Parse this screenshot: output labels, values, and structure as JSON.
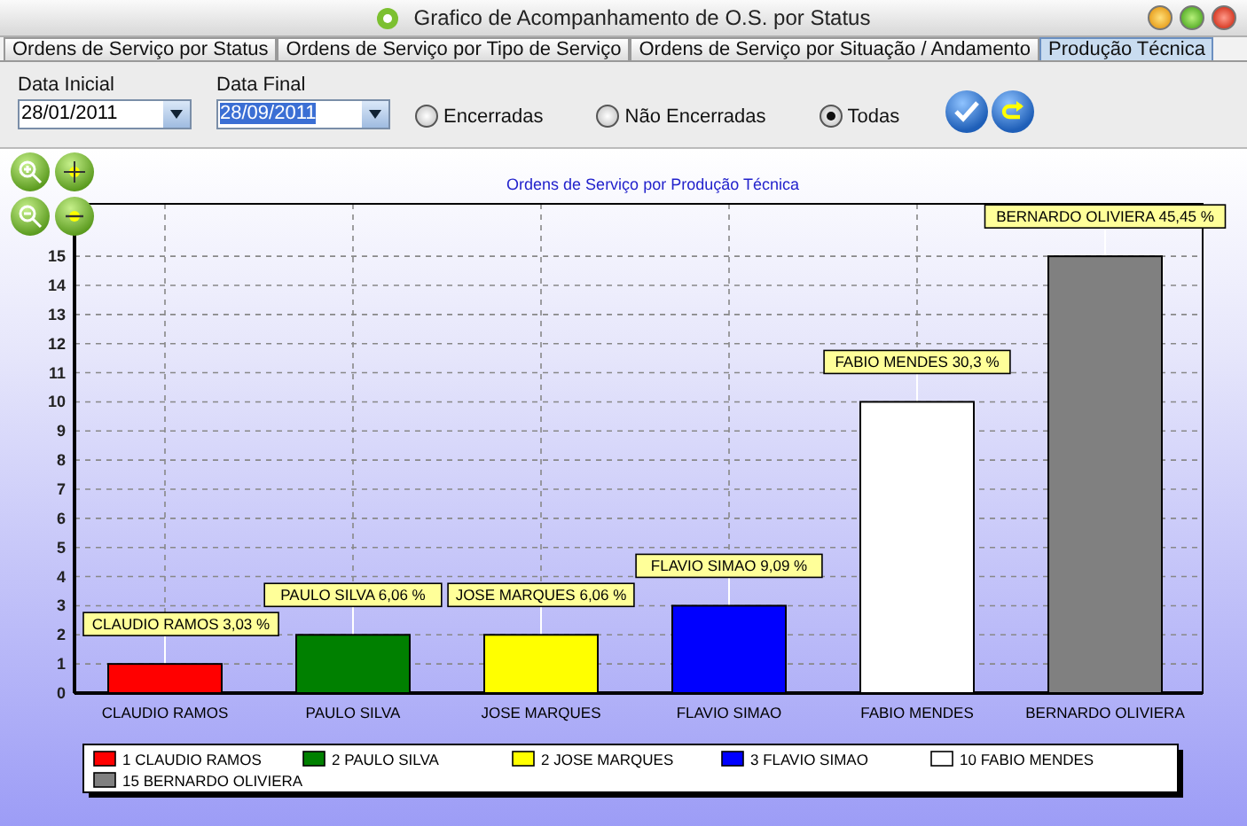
{
  "window": {
    "title": "Grafico de Acompanhamento de O.S. por Status"
  },
  "tabs": [
    {
      "label": "Ordens de Serviço por Status",
      "selected": false
    },
    {
      "label": "Ordens de Serviço por Tipo de Serviço",
      "selected": false
    },
    {
      "label": "Ordens de Serviço por Situação / Andamento",
      "selected": false
    },
    {
      "label": "Produção Técnica",
      "selected": true
    }
  ],
  "filters": {
    "start_date": {
      "label": "Data Inicial",
      "value": "28/01/2011",
      "text_selected": false
    },
    "end_date": {
      "label": "Data Final",
      "value": "28/09/2011",
      "text_selected": true
    },
    "status_options": [
      {
        "label": "Encerradas",
        "selected": false
      },
      {
        "label": "Não Encerradas",
        "selected": false
      },
      {
        "label": "Todas",
        "selected": true
      }
    ]
  },
  "chart": {
    "chart_data": {
      "type": "bar",
      "title": "Ordens de Serviço por Produção Técnica",
      "categories": [
        "CLAUDIO RAMOS",
        "PAULO SILVA",
        "JOSE MARQUES",
        "FLAVIO SIMAO",
        "FABIO MENDES",
        "BERNARDO OLIVIERA"
      ],
      "series": [
        {
          "values": [
            1,
            2,
            2,
            3,
            10,
            15
          ]
        }
      ],
      "grid": true,
      "ylim": [
        0,
        16.8
      ],
      "yticks": [
        0,
        1,
        2,
        3,
        4,
        5,
        6,
        7,
        8,
        9,
        10,
        11,
        12,
        13,
        14,
        15
      ],
      "value_labels": [
        "CLAUDIO RAMOS 3,03 %",
        "PAULO SILVA 6,06 %",
        "JOSE MARQUES 6,06 %",
        "FLAVIO SIMAO 9,09 %",
        "FABIO MENDES 30,3 %",
        "BERNARDO OLIVIERA 45,45 %"
      ]
    }
  },
  "legend": [
    {
      "label": "1 CLAUDIO RAMOS",
      "color": "#ff0000"
    },
    {
      "label": "2 PAULO SILVA",
      "color": "#008000"
    },
    {
      "label": "2 JOSE MARQUES",
      "color": "#ffff00"
    },
    {
      "label": "3 FLAVIO SIMAO",
      "color": "#0000ff"
    },
    {
      "label": "10 FABIO MENDES",
      "color": "#ffffff"
    },
    {
      "label": "15 BERNARDO OLIVIERA",
      "color": "#808080"
    }
  ]
}
